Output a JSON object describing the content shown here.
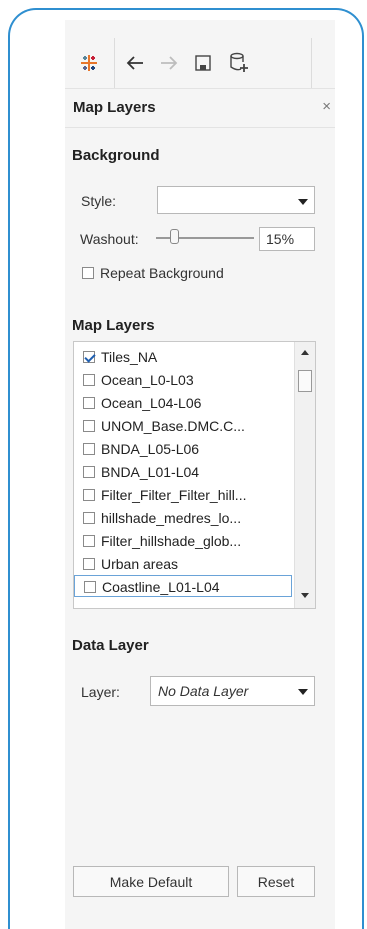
{
  "toolbar": {
    "logo_icon": "tableau-logo-icon",
    "back_icon": "arrow-left-icon",
    "forward_icon": "arrow-right-icon",
    "save_icon": "save-icon",
    "new_datasource_icon": "add-datasource-icon"
  },
  "panel": {
    "title": "Map Layers",
    "close_glyph": "×"
  },
  "background": {
    "title": "Background",
    "style_label": "Style:",
    "style_value": "",
    "washout_label": "Washout:",
    "washout_percent": 15,
    "washout_value": "15%",
    "repeat_label": "Repeat Background",
    "repeat_checked": false
  },
  "map_layers": {
    "title": "Map Layers",
    "items": [
      {
        "label": "Tiles_NA",
        "checked": true
      },
      {
        "label": "Ocean_L0-L03",
        "checked": false
      },
      {
        "label": "Ocean_L04-L06",
        "checked": false
      },
      {
        "label": "UNOM_Base.DMC.C...",
        "checked": false
      },
      {
        "label": "BNDA_L05-L06",
        "checked": false
      },
      {
        "label": "BNDA_L01-L04",
        "checked": false
      },
      {
        "label": "Filter_Filter_Filter_hill...",
        "checked": false
      },
      {
        "label": "hillshade_medres_lo...",
        "checked": false
      },
      {
        "label": "Filter_hillshade_glob...",
        "checked": false
      },
      {
        "label": "Urban areas",
        "checked": false
      },
      {
        "label": "Coastline_L01-L04",
        "checked": false
      }
    ]
  },
  "data_layer": {
    "title": "Data Layer",
    "layer_label": "Layer:",
    "layer_value": "No Data Layer"
  },
  "buttons": {
    "make_default": "Make Default",
    "reset": "Reset"
  },
  "colors": {
    "frame_border": "#2f8fd0",
    "check_mark": "#1f5fb0",
    "panel_bg": "#f5f5f5"
  }
}
